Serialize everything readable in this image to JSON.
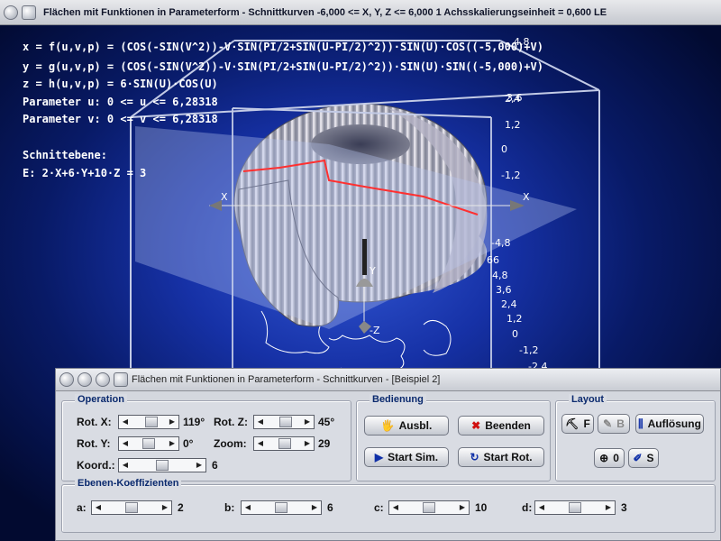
{
  "window": {
    "title": "Flächen mit Funktionen in Parameterform - Schnittkurven   -6,000 <= X, Y, Z <= 6,000    1 Achsskalierungseinheit = 0,600 LE"
  },
  "formulas": {
    "x": "x = f(u,v,p) = (COS(-SIN(V^2))-V·SIN(PI/2+SIN(U-PI/2)^2))·SIN(U)·COS((-5,000)+V)",
    "y": "y = g(u,v,p) = (COS(-SIN(V^2))-V·SIN(PI/2+SIN(U-PI/2)^2))·SIN(U)·SIN((-5,000)+V)",
    "z": "z = h(u,v,p) = 6·SIN(U)·COS(U)",
    "param_u": "Parameter u: 0 <= u <= 6,28318",
    "param_v": "Parameter v: 0 <= v <= 6,28318",
    "plane_title": "Schnittebene:",
    "plane_eq": "E: 2·X+6·Y+10·Z = 3"
  },
  "ticks_upper": [
    "4,8",
    "3,6",
    "2,4",
    "1,2",
    "0",
    "-1,2",
    "-4,8"
  ],
  "ticks_lower": [
    "66",
    "4,8",
    "3,6",
    "2,4",
    "1,2",
    "0",
    "-1,2",
    "-2,4"
  ],
  "axes": {
    "x_neg": "X",
    "x_pos": "X",
    "y": "Y",
    "z": "-Z"
  },
  "panel": {
    "title": "Flächen mit Funktionen in Parameterform - Schnittkurven - [Beispiel 2]",
    "operation": {
      "title": "Operation",
      "rot_x": {
        "label": "Rot. X:",
        "value": "119°",
        "pos": 0.62
      },
      "rot_z": {
        "label": "Rot. Z:",
        "value": "45°",
        "pos": 0.6
      },
      "rot_y": {
        "label": "Rot. Y:",
        "value": "0°",
        "pos": 0.5
      },
      "zoom": {
        "label": "Zoom:",
        "value": "29",
        "pos": 0.55
      },
      "koord": {
        "label": "Koord.:",
        "value": "6",
        "pos": 0.5
      }
    },
    "bedienung": {
      "title": "Bedienung",
      "ausbl": "Ausbl.",
      "beenden": "Beenden",
      "start_sim": "Start Sim.",
      "start_rot": "Start Rot."
    },
    "layout": {
      "title": "Layout",
      "f": "F",
      "b": "B",
      "aufloesung": "Auflösung",
      "zero": "0",
      "s": "S"
    },
    "ebenen": {
      "title": "Ebenen-Koeffizienten",
      "a": {
        "label": "a:",
        "value": "2",
        "pos": 0.5
      },
      "b": {
        "label": "b:",
        "value": "6",
        "pos": 0.5
      },
      "c": {
        "label": "c:",
        "value": "10",
        "pos": 0.5
      },
      "d": {
        "label": "d:",
        "value": "3",
        "pos": 0.5
      }
    }
  }
}
